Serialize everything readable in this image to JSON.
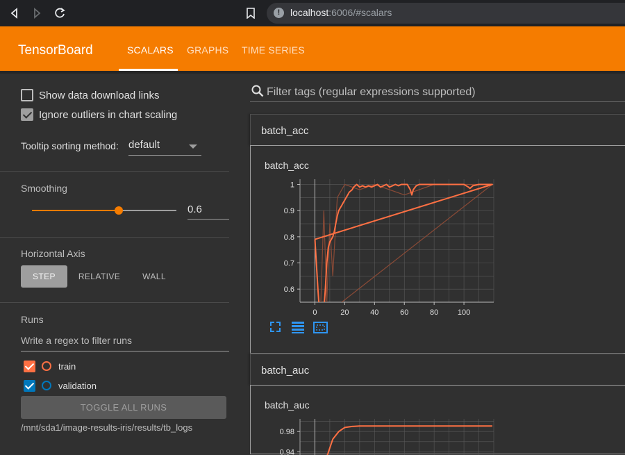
{
  "browser": {
    "url_host": "localhost",
    "url_rest": ":6006/#scalars",
    "icons": [
      "back-icon",
      "forward-icon",
      "reload-icon",
      "bookmark-icon",
      "info-icon"
    ]
  },
  "header": {
    "brand": "TensorBoard",
    "tabs": [
      {
        "label": "SCALARS",
        "active": true
      },
      {
        "label": "GRAPHS",
        "active": false
      },
      {
        "label": "TIME SERIES",
        "active": false
      }
    ],
    "color": "#f57c00"
  },
  "sidebar": {
    "show_download_links": {
      "label": "Show data download links",
      "checked": false
    },
    "ignore_outliers": {
      "label": "Ignore outliers in chart scaling",
      "checked": true
    },
    "tooltip_sorting": {
      "label": "Tooltip sorting method:",
      "value": "default"
    },
    "smoothing": {
      "title": "Smoothing",
      "value": "0.6",
      "fraction": 0.6
    },
    "horizontal_axis": {
      "title": "Horizontal Axis",
      "options": [
        {
          "label": "STEP",
          "active": true
        },
        {
          "label": "RELATIVE",
          "active": false
        },
        {
          "label": "WALL",
          "active": false
        }
      ]
    },
    "runs": {
      "title": "Runs",
      "filter_placeholder": "Write a regex to filter runs",
      "items": [
        {
          "label": "train",
          "checked": true,
          "color": "#ff7043"
        },
        {
          "label": "validation",
          "checked": true,
          "color": "#0077bb"
        }
      ],
      "toggle_label": "TOGGLE ALL RUNS",
      "logdir": "/mnt/sda1/image-results-iris/results/tb_logs"
    }
  },
  "main": {
    "filter_placeholder": "Filter tags (regular expressions supported)",
    "groups": [
      {
        "title": "batch_acc",
        "card_title": "batch_acc"
      },
      {
        "title": "batch_auc",
        "card_title": "batch_auc"
      }
    ],
    "card_icons": [
      "fullscreen-icon",
      "data-list-icon",
      "fit-domain-icon"
    ]
  },
  "chart_data": [
    {
      "type": "line",
      "title": "batch_acc",
      "xlim": [
        -10,
        120
      ],
      "ylim": [
        0.55,
        1.02
      ],
      "x_ticks": [
        0,
        20,
        40,
        60,
        80,
        100
      ],
      "y_ticks": [
        0.6,
        0.7,
        0.8,
        0.9,
        1
      ],
      "grid": true,
      "series": [
        {
          "name": "train",
          "color": "#ff7043",
          "x": [
            0,
            2,
            3,
            4,
            5,
            6,
            7,
            8,
            9,
            10,
            11,
            12,
            13,
            14,
            15,
            16,
            17,
            18,
            19,
            20,
            21,
            22,
            23,
            24,
            25,
            26,
            28,
            30,
            32,
            34,
            36,
            38,
            40,
            42,
            44,
            46,
            48,
            50,
            52,
            54,
            56,
            58,
            60,
            62,
            64,
            65,
            66,
            68,
            70,
            75,
            80,
            85,
            90,
            95,
            100,
            103,
            104,
            106,
            110,
            119,
            0
          ],
          "y": [
            0.79,
            0.6,
            0.52,
            0.5,
            0.48,
            0.52,
            0.6,
            0.7,
            0.76,
            0.78,
            0.79,
            0.8,
            0.82,
            0.85,
            0.88,
            0.9,
            0.91,
            0.92,
            0.93,
            0.94,
            0.95,
            0.96,
            0.97,
            0.975,
            0.98,
            0.99,
            1.0,
            0.99,
            0.995,
            0.99,
            0.995,
            0.99,
            0.995,
            1.0,
            0.99,
            0.995,
            1.0,
            0.99,
            0.995,
            1.0,
            0.995,
            1.0,
            1.0,
            1.0,
            0.98,
            0.96,
            0.98,
            0.995,
            1.0,
            1.0,
            1.0,
            1.0,
            1.0,
            1.0,
            1.0,
            0.99,
            0.985,
            0.995,
            1.0,
            1.0,
            0.79
          ]
        },
        {
          "name": "train (raw)",
          "color": "#8a4a36",
          "x": [
            4,
            6,
            8,
            10,
            12,
            15,
            20,
            30,
            40,
            60,
            80,
            100,
            119
          ],
          "y": [
            0.55,
            0.9,
            0.55,
            0.85,
            0.65,
            0.95,
            1.0,
            0.98,
            1.0,
            0.96,
            1.0,
            1.0,
            1.0
          ]
        },
        {
          "name": "trend (raw)",
          "color": "#8a4a36",
          "x": [
            18,
            119
          ],
          "y": [
            0.55,
            1.0
          ]
        }
      ]
    },
    {
      "type": "line",
      "title": "batch_auc",
      "xlim": [
        -10,
        120
      ],
      "ylim": [
        0.92,
        1.005
      ],
      "y_ticks": [
        0.94,
        0.98
      ],
      "grid": true,
      "series": [
        {
          "name": "train",
          "color": "#ff7043",
          "x": [
            2,
            5,
            8,
            12,
            16,
            20,
            25,
            30,
            40,
            60,
            80,
            100,
            119
          ],
          "y": [
            0.9,
            0.9,
            0.93,
            0.965,
            0.98,
            0.988,
            0.99,
            0.991,
            0.991,
            0.991,
            0.991,
            0.991,
            0.991
          ]
        }
      ]
    }
  ]
}
